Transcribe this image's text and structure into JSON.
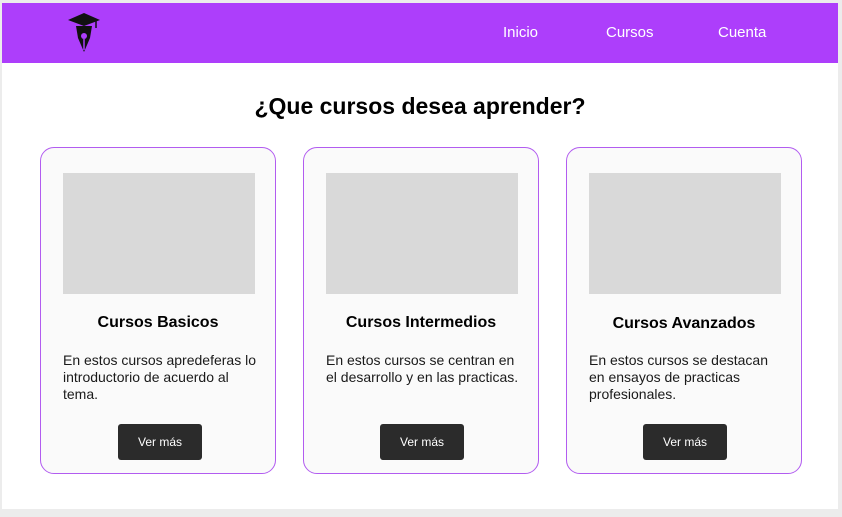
{
  "nav": {
    "logo_icon": "graduation-pen-icon",
    "links": [
      {
        "label": "Inicio"
      },
      {
        "label": "Cursos"
      },
      {
        "label": "Cuenta"
      }
    ],
    "background": "#ad3efb"
  },
  "main": {
    "title": "¿Que cursos desea aprender?",
    "cards": [
      {
        "title": "Cursos Basicos",
        "text": "En estos cursos apredeferas lo introductorio de acuerdo al tema.",
        "button_label": "Ver más"
      },
      {
        "title": "Cursos Intermedios",
        "text": "En estos cursos se centran en el desarrollo y en las practicas.",
        "button_label": "Ver más"
      },
      {
        "title": "Cursos Avanzados",
        "text": "En estos cursos se destacan en ensayos de practicas profesionales.",
        "button_label": "Ver más"
      }
    ]
  },
  "colors": {
    "accent": "#ad3efb",
    "card_border": "#b25cf0",
    "button": "#2b2b2b",
    "placeholder_image": "#d9d9d9"
  }
}
